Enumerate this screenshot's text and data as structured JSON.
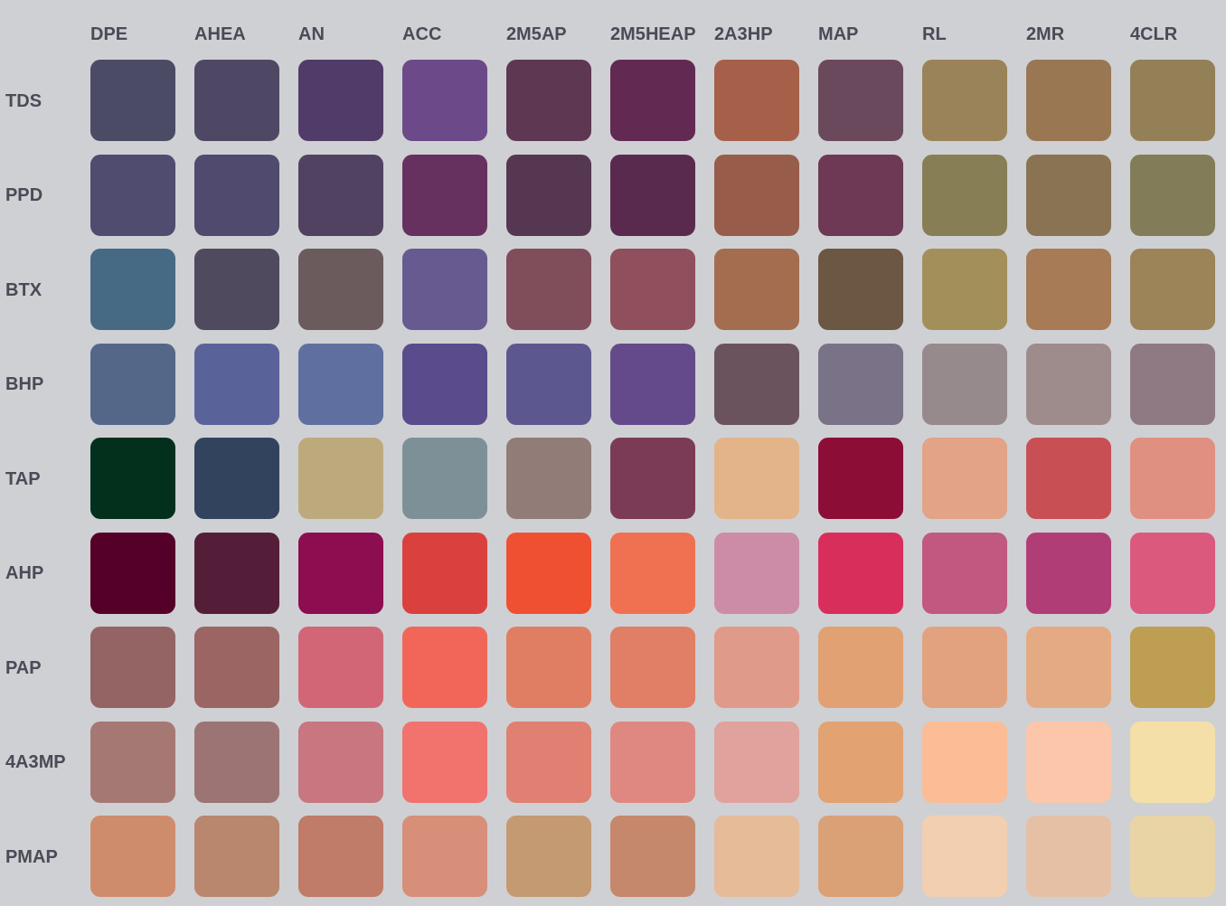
{
  "columns": [
    "DPE",
    "AHEA",
    "AN",
    "ACC",
    "2M5AP",
    "2M5HEAP",
    "2A3HP",
    "MAP",
    "RL",
    "2MR",
    "4CLR"
  ],
  "rows": [
    {
      "label": "TDS",
      "cells": [
        {
          "color": "#4b4b66"
        },
        {
          "color": "#4f4865"
        },
        {
          "color": "#513c69"
        },
        {
          "color": "#6c4a89"
        },
        {
          "color": "#5e3752"
        },
        {
          "color": "#622a52"
        },
        {
          "color": "#a6604a"
        },
        {
          "color": "#6b495c"
        },
        {
          "color": "#9a8358"
        },
        {
          "color": "#9a7753"
        },
        {
          "color": "#938057"
        }
      ]
    },
    {
      "label": "PPD",
      "cells": [
        {
          "color": "#4f4c70"
        },
        {
          "color": "#4f4a6e"
        },
        {
          "color": "#514262"
        },
        {
          "color": "#67315f"
        },
        {
          "color": "#553751"
        },
        {
          "color": "#5a2a4e"
        },
        {
          "color": "#975c4a"
        },
        {
          "color": "#6d3954"
        },
        {
          "color": "#877e56"
        },
        {
          "color": "#8a7353"
        },
        {
          "color": "#827c58"
        }
      ]
    },
    {
      "label": "BTX",
      "cells": [
        {
          "color": "#476a84"
        },
        {
          "color": "#504a5e"
        },
        {
          "color": "#6b5b5d"
        },
        {
          "color": "#675a90"
        },
        {
          "color": "#804d5b"
        },
        {
          "color": "#8f4f5c"
        },
        {
          "color": "#a56d4f"
        },
        {
          "color": "#6b5743"
        },
        {
          "color": "#a28f5a"
        },
        {
          "color": "#a77b56"
        },
        {
          "color": "#9c8358"
        }
      ]
    },
    {
      "label": "BHP",
      "cells": [
        {
          "color": "#546789"
        },
        {
          "color": "#596399"
        },
        {
          "color": "#5f70a0"
        },
        {
          "color": "#5a4b8c"
        },
        {
          "color": "#5d5790"
        },
        {
          "color": "#644a8a"
        },
        {
          "color": "#6b535e"
        },
        {
          "color": "#7a7287"
        },
        {
          "color": "#978a8d"
        },
        {
          "color": "#9e8b8c"
        },
        {
          "color": "#8f7a83"
        }
      ]
    },
    {
      "label": "TAP",
      "cells": [
        {
          "color": "#03301c"
        },
        {
          "color": "#32435e"
        },
        {
          "color": "#bdaa7c"
        },
        {
          "color": "#7e9097"
        },
        {
          "color": "#917c77"
        },
        {
          "color": "#7b3b57"
        },
        {
          "color": "#e3b48a"
        },
        {
          "color": "#8c0e37"
        },
        {
          "color": "#e2a386"
        },
        {
          "color": "#c85055"
        },
        {
          "color": "#e09080"
        }
      ]
    },
    {
      "label": "AHP",
      "cells": [
        {
          "color": "#550029"
        },
        {
          "color": "#551e38"
        },
        {
          "color": "#8d0d51"
        },
        {
          "color": "#da413e"
        },
        {
          "color": "#ef5032"
        },
        {
          "color": "#f07052"
        },
        {
          "color": "#cc8ca8"
        },
        {
          "color": "#d82e5c"
        },
        {
          "color": "#c05880"
        },
        {
          "color": "#b13d76"
        },
        {
          "color": "#dc597e"
        }
      ]
    },
    {
      "label": "PAP",
      "cells": [
        {
          "color": "#946464"
        },
        {
          "color": "#9b6564"
        },
        {
          "color": "#d26677"
        },
        {
          "color": "#f2665a"
        },
        {
          "color": "#e07e64"
        },
        {
          "color": "#e07e66"
        },
        {
          "color": "#e09a8a"
        },
        {
          "color": "#e2a172"
        },
        {
          "color": "#e2a27f"
        },
        {
          "color": "#e4aa84"
        },
        {
          "color": "#bd9e52"
        }
      ]
    },
    {
      "label": "4A3MP",
      "cells": [
        {
          "color": "#a67874"
        },
        {
          "color": "#9c7474"
        },
        {
          "color": "#c87680"
        },
        {
          "color": "#f2726e"
        },
        {
          "color": "#e08072"
        },
        {
          "color": "#df8882"
        },
        {
          "color": "#e0a29c"
        },
        {
          "color": "#e2a272"
        },
        {
          "color": "#fbbc96"
        },
        {
          "color": "#fbc6aa"
        },
        {
          "color": "#f4dfa8"
        }
      ]
    },
    {
      "label": "PMAP",
      "cells": [
        {
          "color": "#cf8c6c"
        },
        {
          "color": "#b9876d"
        },
        {
          "color": "#c07b69"
        },
        {
          "color": "#d78f7a"
        },
        {
          "color": "#c49a72"
        },
        {
          "color": "#c5886c"
        },
        {
          "color": "#e5bb98"
        },
        {
          "color": "#dba176"
        },
        {
          "color": "#f1cfb0"
        },
        {
          "color": "#e6c0a4"
        },
        {
          "color": "#e9d4a6"
        }
      ]
    }
  ]
}
